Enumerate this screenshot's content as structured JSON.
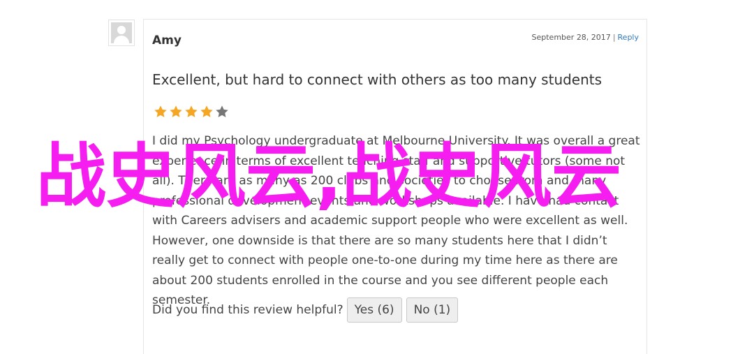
{
  "review": {
    "author": "Amy",
    "date": "September 28, 2017",
    "separator": "|",
    "reply_label": "Reply",
    "title": "Excellent, but hard to connect with others as too many students",
    "rating": 4,
    "rating_max": 5,
    "star_color_filled": "#f5a623",
    "star_color_empty": "#777777",
    "body": "I did my Psychology undergraduate at Melbourne University. It was overall a great experience in terms of excellent teaching staff and supportive tutors (some not all). There are as many as 200 clubs and societies to choose from and many professional development events and workshops available. I have had contact with Careers advisers and academic support people who were excellent as well. However, one downside is that there are so many students here that I didn’t really get to connect with people one-to-one during my time here as there are about 200 students enrolled in the course and you see different people each semester.",
    "helpful_question": "Did you find this review helpful?",
    "yes_label": "Yes (6)",
    "no_label": "No (1)"
  },
  "overlay": {
    "watermark_text": "战史风云,战史风云",
    "watermark_color": "#f51df0"
  },
  "icons": {
    "avatar": "default-avatar-icon",
    "star": "star-icon"
  }
}
